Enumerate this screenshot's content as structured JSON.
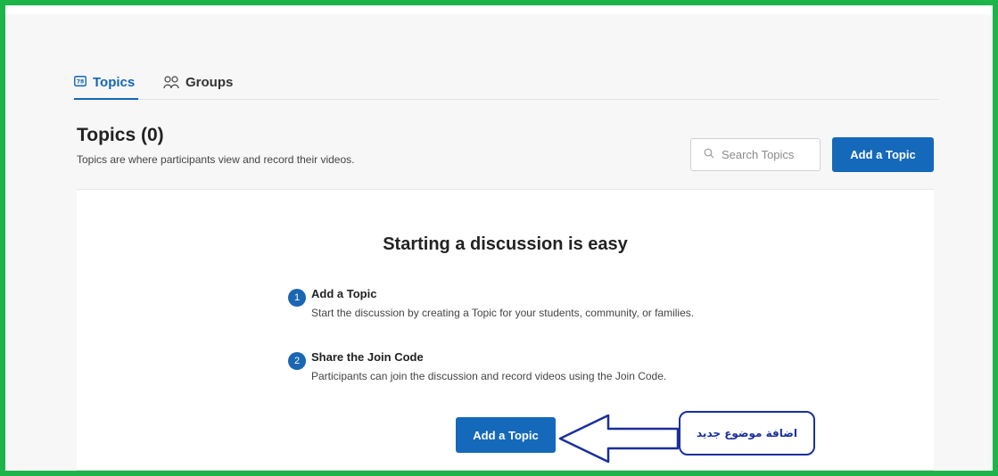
{
  "tabs": [
    {
      "label": "Topics",
      "icon": "topic-icon",
      "active": true
    },
    {
      "label": "Groups",
      "icon": "groups-icon",
      "active": false
    }
  ],
  "header": {
    "title": "Topics (0)",
    "subtitle": "Topics are where participants view and record their videos."
  },
  "search": {
    "placeholder": "Search Topics",
    "value": ""
  },
  "actions": {
    "add_topic_label": "Add a Topic"
  },
  "empty_state": {
    "title": "Starting a discussion is easy",
    "steps": [
      {
        "number": "1",
        "title": "Add a Topic",
        "description": "Start the discussion by creating a Topic for your students, community, or families."
      },
      {
        "number": "2",
        "title": "Share the Join Code",
        "description": "Participants can join the discussion and record videos using the Join Code."
      }
    ],
    "button_label": "Add a Topic"
  },
  "annotation": {
    "text": "اضافة موضوع جديد"
  },
  "colors": {
    "accent": "#1469ba",
    "frame": "#1db44a",
    "annotation": "#1a2f9c"
  }
}
